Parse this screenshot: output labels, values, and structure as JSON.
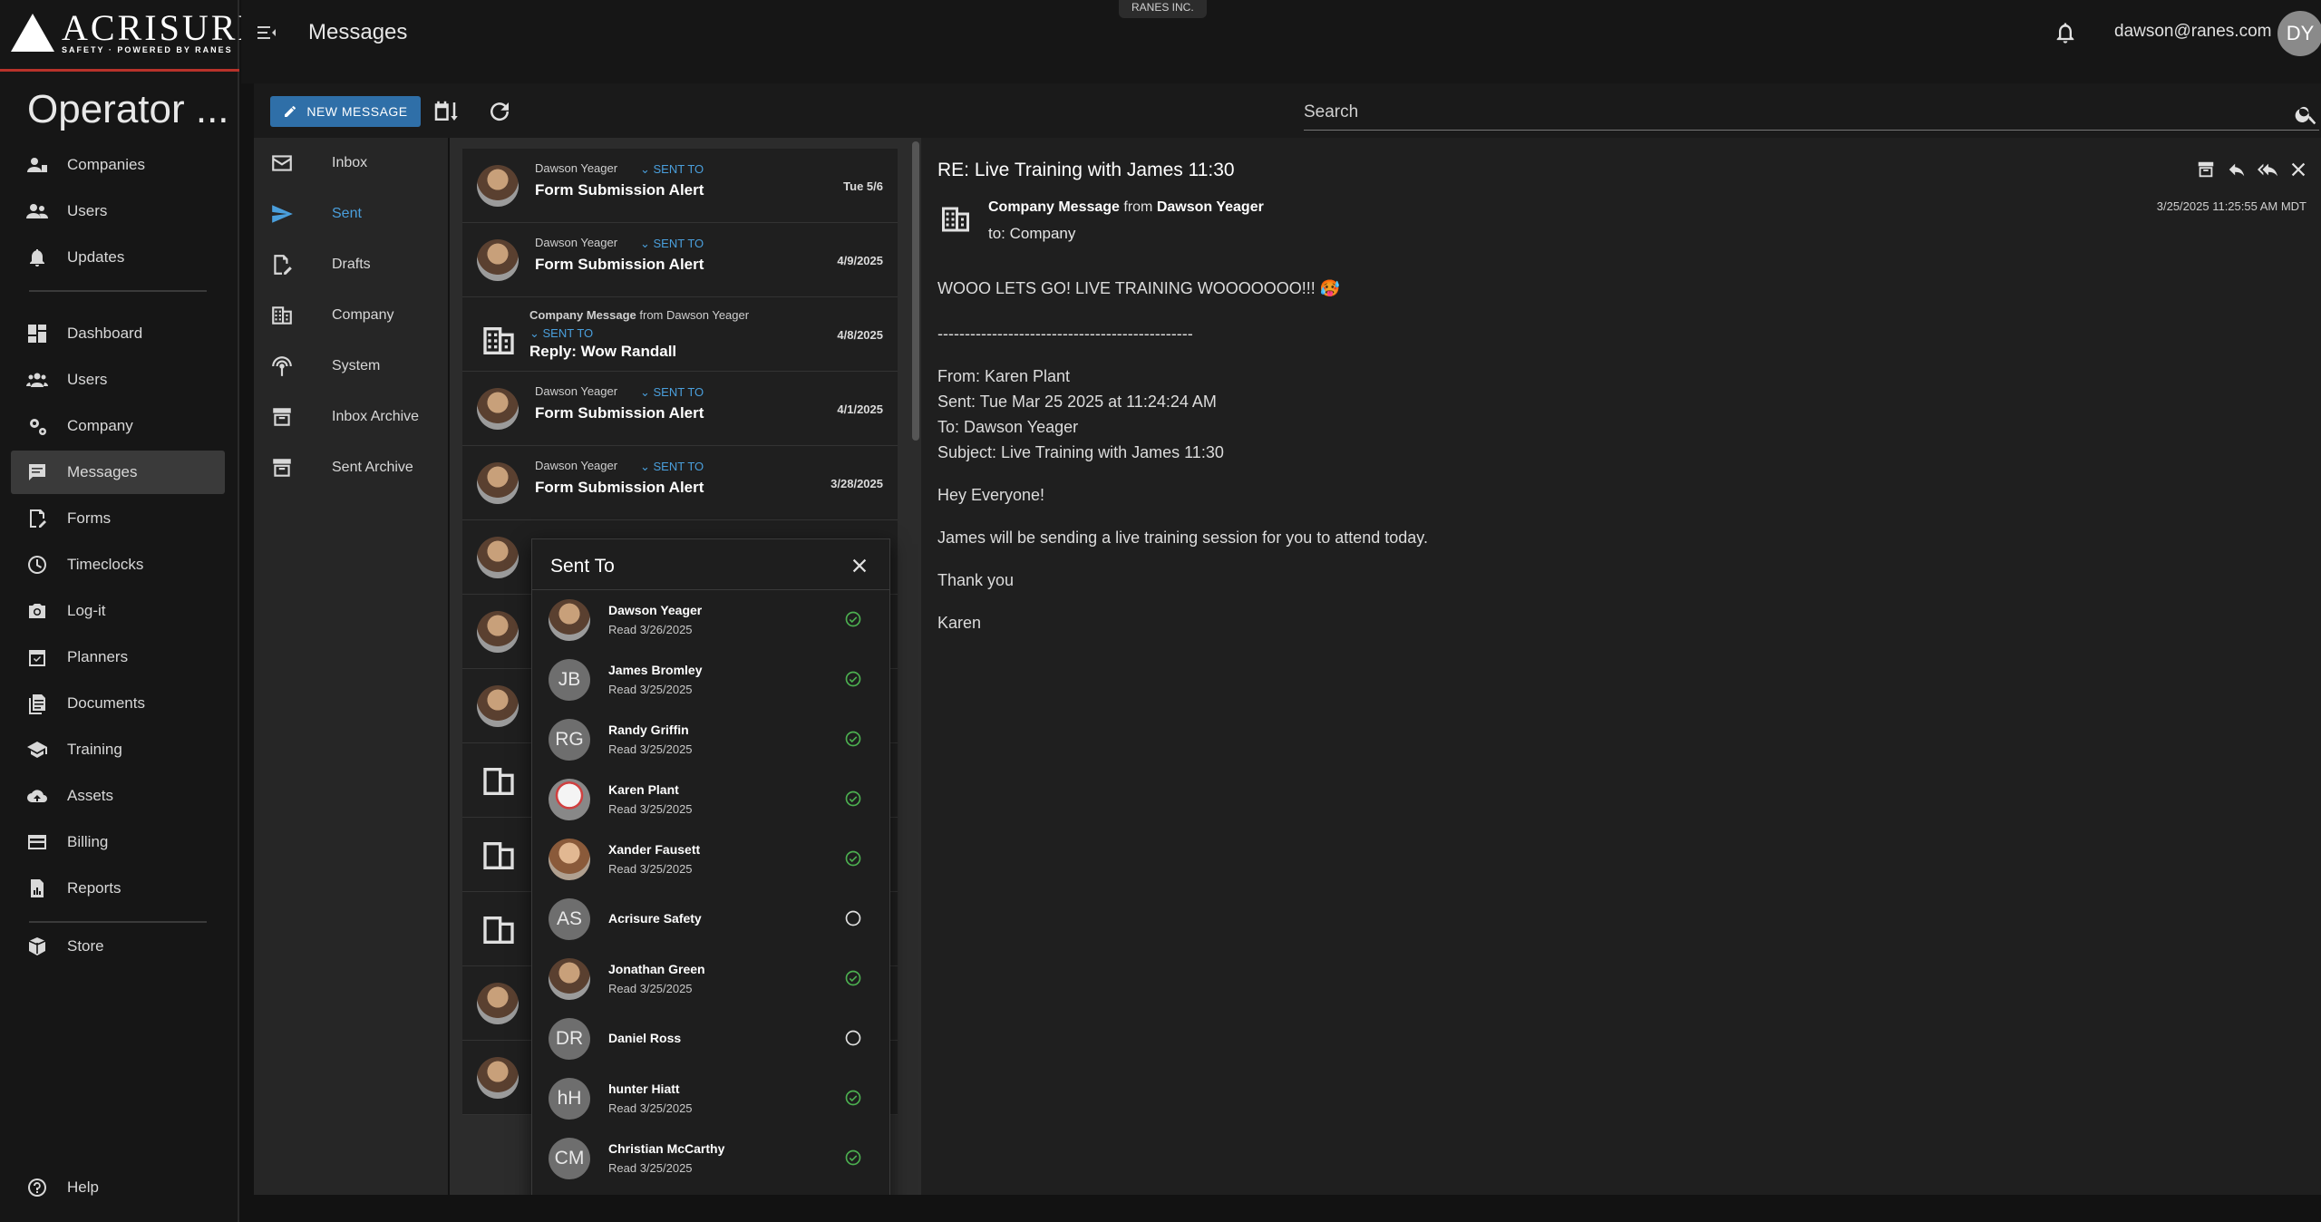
{
  "brand": {
    "name": "ACRISURE",
    "tagline": "SAFETY · POWERED BY RANES"
  },
  "sidebar": {
    "title": "Operator ...",
    "group1": [
      {
        "label": "Companies",
        "icon": "companies-icon"
      },
      {
        "label": "Users",
        "icon": "users-icon"
      },
      {
        "label": "Updates",
        "icon": "bell-icon"
      }
    ],
    "group2": [
      {
        "label": "Dashboard",
        "icon": "dashboard-icon"
      },
      {
        "label": "Users",
        "icon": "users-icon"
      },
      {
        "label": "Company",
        "icon": "gears-icon"
      },
      {
        "label": "Messages",
        "icon": "chat-icon",
        "active": true
      },
      {
        "label": "Forms",
        "icon": "forms-icon"
      },
      {
        "label": "Timeclocks",
        "icon": "clock-icon"
      },
      {
        "label": "Log-it",
        "icon": "camera-icon"
      },
      {
        "label": "Planners",
        "icon": "calendar-icon"
      },
      {
        "label": "Documents",
        "icon": "documents-icon"
      },
      {
        "label": "Training",
        "icon": "graduation-icon"
      },
      {
        "label": "Assets",
        "icon": "cloud-icon"
      },
      {
        "label": "Billing",
        "icon": "credit-card-icon"
      },
      {
        "label": "Reports",
        "icon": "reports-icon"
      }
    ],
    "group3": [
      {
        "label": "Store",
        "icon": "store-icon"
      }
    ],
    "help": {
      "label": "Help",
      "icon": "help-icon"
    }
  },
  "header": {
    "title": "Messages",
    "company": "RANES INC.",
    "email": "dawson@ranes.com",
    "avatar_initials": "DY"
  },
  "toolbar": {
    "new_message": "NEW MESSAGE",
    "search_placeholder": "Search"
  },
  "folders": [
    {
      "label": "Inbox",
      "icon": "mail-icon"
    },
    {
      "label": "Sent",
      "icon": "send-icon",
      "active": true
    },
    {
      "label": "Drafts",
      "icon": "drafts-icon"
    },
    {
      "label": "Company",
      "icon": "building-icon"
    },
    {
      "label": "System",
      "icon": "broadcast-icon"
    },
    {
      "label": "Inbox Archive",
      "icon": "archive-icon"
    },
    {
      "label": "Sent Archive",
      "icon": "archive-icon"
    }
  ],
  "messages": [
    {
      "from": "Dawson Yeager",
      "sent_to": "SENT TO",
      "subject": "Form Submission Alert",
      "date": "Tue 5/6",
      "kind": "user"
    },
    {
      "from": "Dawson Yeager",
      "sent_to": "SENT TO",
      "subject": "Form Submission Alert",
      "date": "4/9/2025",
      "kind": "user"
    },
    {
      "from_prefix": "Company Message",
      "from_mid": " from ",
      "from": "Dawson Yeager",
      "sent_to": "SENT TO",
      "subject": "Reply: Wow Randall",
      "date": "4/8/2025",
      "kind": "company"
    },
    {
      "from": "Dawson Yeager",
      "sent_to": "SENT TO",
      "subject": "Form Submission Alert",
      "date": "4/1/2025",
      "kind": "user"
    },
    {
      "from": "Dawson Yeager",
      "sent_to": "SENT TO",
      "subject": "Form Submission Alert",
      "date": "3/28/2025",
      "kind": "user"
    }
  ],
  "sent_to_popup": {
    "title": "Sent To",
    "recipients": [
      {
        "name": "Dawson Yeager",
        "read": "Read 3/26/2025",
        "avatar": "photo",
        "status": "read"
      },
      {
        "name": "James Bromley",
        "read": "Read 3/25/2025",
        "initials": "JB",
        "status": "read"
      },
      {
        "name": "Randy Griffin",
        "read": "Read 3/25/2025",
        "initials": "RG",
        "status": "read"
      },
      {
        "name": "Karen Plant",
        "read": "Read 3/25/2025",
        "avatar": "photo-light",
        "status": "read"
      },
      {
        "name": "Xander Fausett",
        "read": "Read 3/25/2025",
        "avatar": "photo-f",
        "status": "read"
      },
      {
        "name": "Acrisure Safety",
        "read": "",
        "initials": "AS",
        "status": "unread"
      },
      {
        "name": "Jonathan Green",
        "read": "Read 3/25/2025",
        "avatar": "photo",
        "status": "read"
      },
      {
        "name": "Daniel Ross",
        "read": "",
        "initials": "DR",
        "status": "unread"
      },
      {
        "name": "hunter Hiatt",
        "read": "Read 3/25/2025",
        "initials": "hH",
        "status": "read"
      },
      {
        "name": "Christian McCarthy",
        "read": "Read 3/25/2025",
        "initials": "CM",
        "status": "read"
      }
    ]
  },
  "reader": {
    "subject": "RE: Live Training with James 11:30",
    "from_prefix": "Company Message",
    "from_mid": " from ",
    "from_name": "Dawson Yeager",
    "to": "to: Company",
    "date": "3/25/2025 11:25:55 AM MDT",
    "line1": "WOOO LETS GO! LIVE TRAINING WOOOOOOO!!! 🥵",
    "separator": "-----------------------------------------------",
    "q_from": "From: Karen Plant",
    "q_sent": "Sent: Tue Mar 25 2025 at 11:24:24 AM",
    "q_to": "To: Dawson Yeager",
    "q_subject": "Subject: Live Training with James 11:30",
    "p1": "Hey Everyone!",
    "p2": "James will be sending a live training session for you to attend today.",
    "p3": "Thank you",
    "p4": "Karen"
  },
  "colors": {
    "accent": "#4a9fdc",
    "button": "#2f6fa8",
    "brand_red": "#b8322a",
    "status_green": "#4caf50"
  }
}
